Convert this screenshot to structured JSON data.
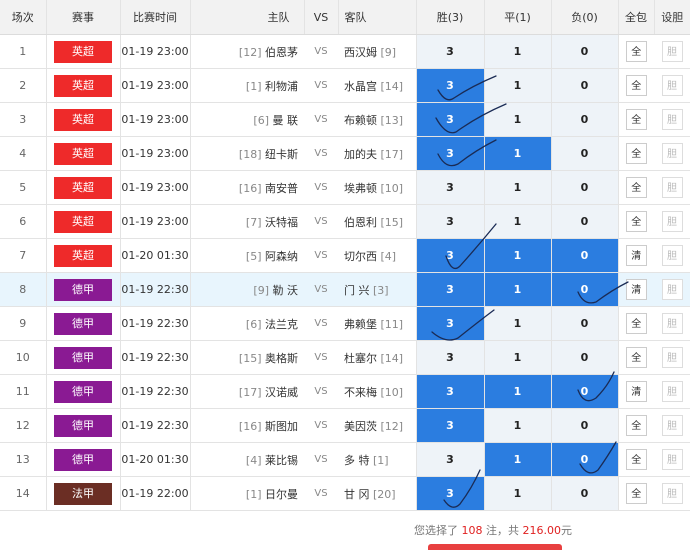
{
  "headers": {
    "no": "场次",
    "league": "赛事",
    "time": "比赛时间",
    "home": "主队",
    "vs": "VS",
    "away": "客队",
    "win": "胜(3)",
    "draw": "平(1)",
    "lose": "负(0)",
    "all": "全包",
    "gall": "设胆"
  },
  "colors": {
    "epl": "#ee2a2a",
    "bundesliga": "#8a1a93",
    "ligue1": "#6b2e24",
    "selected": "#2b7de0"
  },
  "matches": [
    {
      "no": "1",
      "league": "英超",
      "league_key": "epl",
      "time": "01-19 23:00",
      "home_rank": "[12]",
      "home": "伯恩茅",
      "away": "西汉姆",
      "away_rank": "[9]",
      "vs": "VS",
      "win": "3",
      "draw": "1",
      "lose": "0",
      "sel": [],
      "action": "全",
      "bold": "胆"
    },
    {
      "no": "2",
      "league": "英超",
      "league_key": "epl",
      "time": "01-19 23:00",
      "home_rank": "[1]",
      "home": "利物浦",
      "away": "水晶宫",
      "away_rank": "[14]",
      "vs": "VS",
      "win": "3",
      "draw": "1",
      "lose": "0",
      "sel": [
        "win"
      ],
      "action": "全",
      "bold": "胆"
    },
    {
      "no": "3",
      "league": "英超",
      "league_key": "epl",
      "time": "01-19 23:00",
      "home_rank": "[6]",
      "home": "曼 联",
      "away": "布赖顿",
      "away_rank": "[13]",
      "vs": "VS",
      "win": "3",
      "draw": "1",
      "lose": "0",
      "sel": [
        "win"
      ],
      "action": "全",
      "bold": "胆"
    },
    {
      "no": "4",
      "league": "英超",
      "league_key": "epl",
      "time": "01-19 23:00",
      "home_rank": "[18]",
      "home": "纽卡斯",
      "away": "加的夫",
      "away_rank": "[17]",
      "vs": "VS",
      "win": "3",
      "draw": "1",
      "lose": "0",
      "sel": [
        "win",
        "draw"
      ],
      "action": "全",
      "bold": "胆"
    },
    {
      "no": "5",
      "league": "英超",
      "league_key": "epl",
      "time": "01-19 23:00",
      "home_rank": "[16]",
      "home": "南安普",
      "away": "埃弗顿",
      "away_rank": "[10]",
      "vs": "VS",
      "win": "3",
      "draw": "1",
      "lose": "0",
      "sel": [],
      "action": "全",
      "bold": "胆"
    },
    {
      "no": "6",
      "league": "英超",
      "league_key": "epl",
      "time": "01-19 23:00",
      "home_rank": "[7]",
      "home": "沃特福",
      "away": "伯恩利",
      "away_rank": "[15]",
      "vs": "VS",
      "win": "3",
      "draw": "1",
      "lose": "0",
      "sel": [],
      "action": "全",
      "bold": "胆"
    },
    {
      "no": "7",
      "league": "英超",
      "league_key": "epl",
      "time": "01-20 01:30",
      "home_rank": "[5]",
      "home": "阿森纳",
      "away": "切尔西",
      "away_rank": "[4]",
      "vs": "VS",
      "win": "3",
      "draw": "1",
      "lose": "0",
      "sel": [
        "win",
        "draw",
        "lose"
      ],
      "action": "清",
      "bold": "胆"
    },
    {
      "no": "8",
      "league": "德甲",
      "league_key": "bundesliga",
      "time": "01-19 22:30",
      "home_rank": "[9]",
      "home": "勒 沃",
      "away": "门 兴",
      "away_rank": "[3]",
      "vs": "VS",
      "win": "3",
      "draw": "1",
      "lose": "0",
      "sel": [
        "win",
        "draw",
        "lose"
      ],
      "action": "清",
      "bold": "胆",
      "highlight": true
    },
    {
      "no": "9",
      "league": "德甲",
      "league_key": "bundesliga",
      "time": "01-19 22:30",
      "home_rank": "[6]",
      "home": "法兰克",
      "away": "弗赖堡",
      "away_rank": "[11]",
      "vs": "VS",
      "win": "3",
      "draw": "1",
      "lose": "0",
      "sel": [
        "win"
      ],
      "action": "全",
      "bold": "胆"
    },
    {
      "no": "10",
      "league": "德甲",
      "league_key": "bundesliga",
      "time": "01-19 22:30",
      "home_rank": "[15]",
      "home": "奥格斯",
      "away": "杜塞尔",
      "away_rank": "[14]",
      "vs": "VS",
      "win": "3",
      "draw": "1",
      "lose": "0",
      "sel": [],
      "action": "全",
      "bold": "胆"
    },
    {
      "no": "11",
      "league": "德甲",
      "league_key": "bundesliga",
      "time": "01-19 22:30",
      "home_rank": "[17]",
      "home": "汉诺威",
      "away": "不来梅",
      "away_rank": "[10]",
      "vs": "VS",
      "win": "3",
      "draw": "1",
      "lose": "0",
      "sel": [
        "win",
        "draw",
        "lose"
      ],
      "action": "清",
      "bold": "胆"
    },
    {
      "no": "12",
      "league": "德甲",
      "league_key": "bundesliga",
      "time": "01-19 22:30",
      "home_rank": "[16]",
      "home": "斯图加",
      "away": "美因茨",
      "away_rank": "[12]",
      "vs": "VS",
      "win": "3",
      "draw": "1",
      "lose": "0",
      "sel": [
        "win"
      ],
      "action": "全",
      "bold": "胆"
    },
    {
      "no": "13",
      "league": "德甲",
      "league_key": "bundesliga",
      "time": "01-20 01:30",
      "home_rank": "[4]",
      "home": "莱比锡",
      "away": "多 特",
      "away_rank": "[1]",
      "vs": "VS",
      "win": "3",
      "draw": "1",
      "lose": "0",
      "sel": [
        "draw",
        "lose"
      ],
      "action": "全",
      "bold": "胆"
    },
    {
      "no": "14",
      "league": "法甲",
      "league_key": "ligue1",
      "time": "01-19 22:00",
      "home_rank": "[1]",
      "home": "日尔曼",
      "away": "甘 冈",
      "away_rank": "[20]",
      "vs": "VS",
      "win": "3",
      "draw": "1",
      "lose": "0",
      "sel": [
        "win"
      ],
      "action": "全",
      "bold": "胆"
    }
  ],
  "summary": {
    "prefix": "您选择了",
    "bets": "108",
    "mid": "注，共",
    "amount": "216.00",
    "suffix": "元"
  }
}
